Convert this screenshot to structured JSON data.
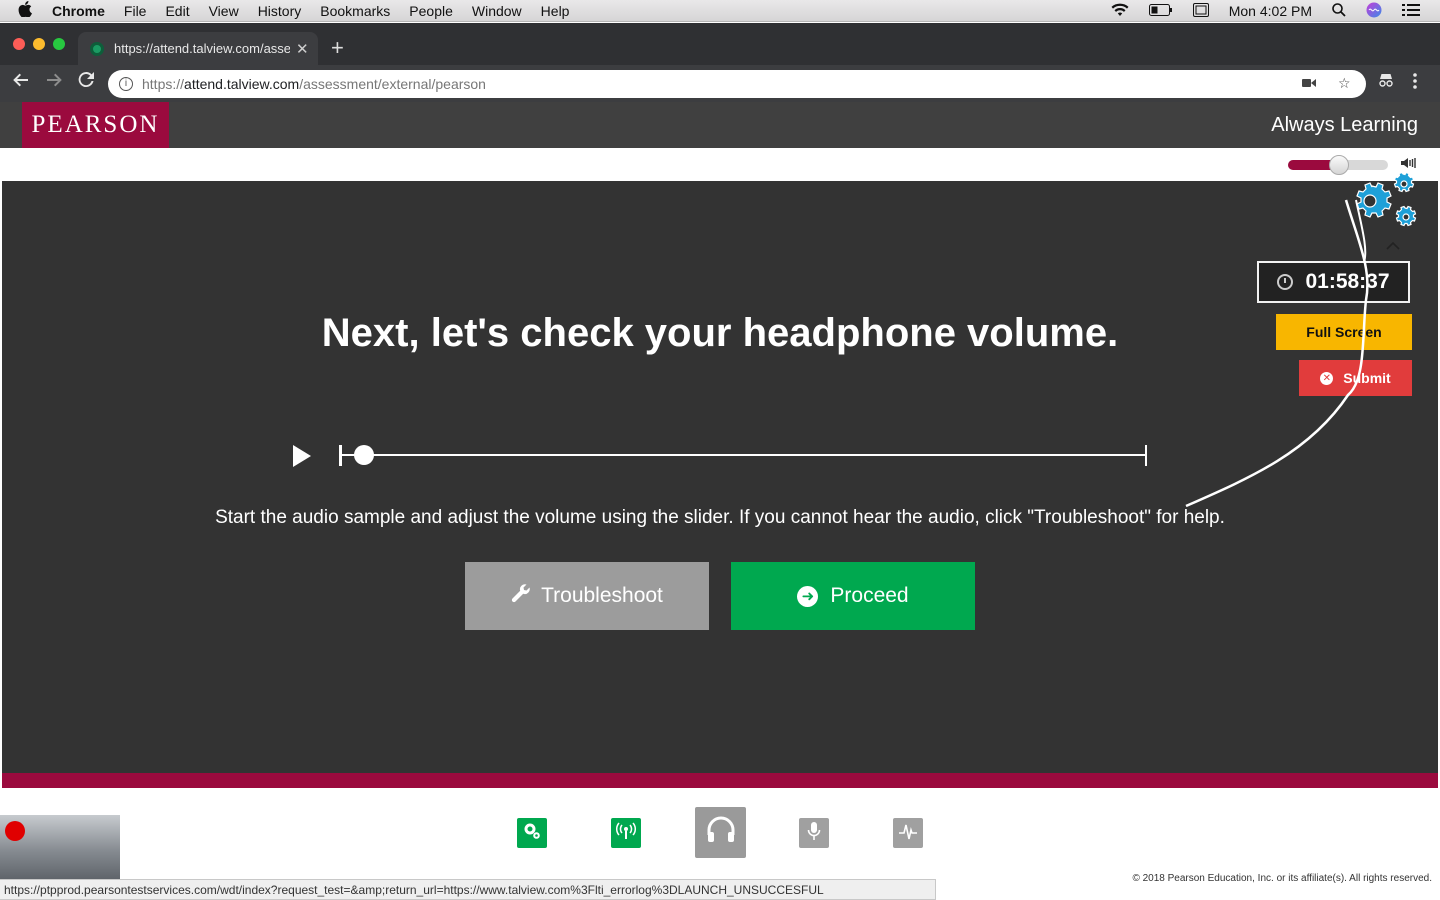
{
  "menubar": {
    "app": "Chrome",
    "items": [
      "File",
      "Edit",
      "View",
      "History",
      "Bookmarks",
      "People",
      "Window",
      "Help"
    ],
    "clock": "Mon 4:02 PM"
  },
  "browser": {
    "tab_title": "https://attend.talview.com/asse",
    "new_tab": "+",
    "url_scheme": "https://",
    "url_host": "attend.talview.com",
    "url_path": "/assessment/external/pearson",
    "status_url": "https://ptpprod.pearsontestservices.com/wdt/index?request_test=&amp;return_url=https://www.talview.com%3Flti_errorlog%3DLAUNCH_UNSUCCESFUL"
  },
  "header": {
    "logo": "PEARSON",
    "tagline": "Always Learning",
    "brand_color": "#9b0a3e"
  },
  "volume": {
    "level": 0.45
  },
  "main": {
    "heading": "Next, let's check your headphone volume.",
    "audio_progress": 0.02,
    "instructions": "Start the audio sample and adjust the volume using the slider. If you cannot hear the audio, click \"Troubleshoot\" for help.",
    "troubleshoot_label": "Troubleshoot",
    "proceed_label": "Proceed"
  },
  "panel": {
    "timer": "01:58:37",
    "fullscreen_label": "Full Screen",
    "submit_label": "Submit",
    "gear_color": "#1ea0d8"
  },
  "steps": [
    {
      "name": "system-check",
      "icon": "gears-icon",
      "state": "done"
    },
    {
      "name": "network-check",
      "icon": "antenna-icon",
      "state": "done"
    },
    {
      "name": "headphone-check",
      "icon": "headphones-icon",
      "state": "active"
    },
    {
      "name": "microphone-check",
      "icon": "microphone-icon",
      "state": "todo"
    },
    {
      "name": "audio-check",
      "icon": "waveform-icon",
      "state": "todo"
    }
  ],
  "footer": {
    "copyright": "© 2018 Pearson Education, Inc. or its affiliate(s). All rights reserved."
  }
}
